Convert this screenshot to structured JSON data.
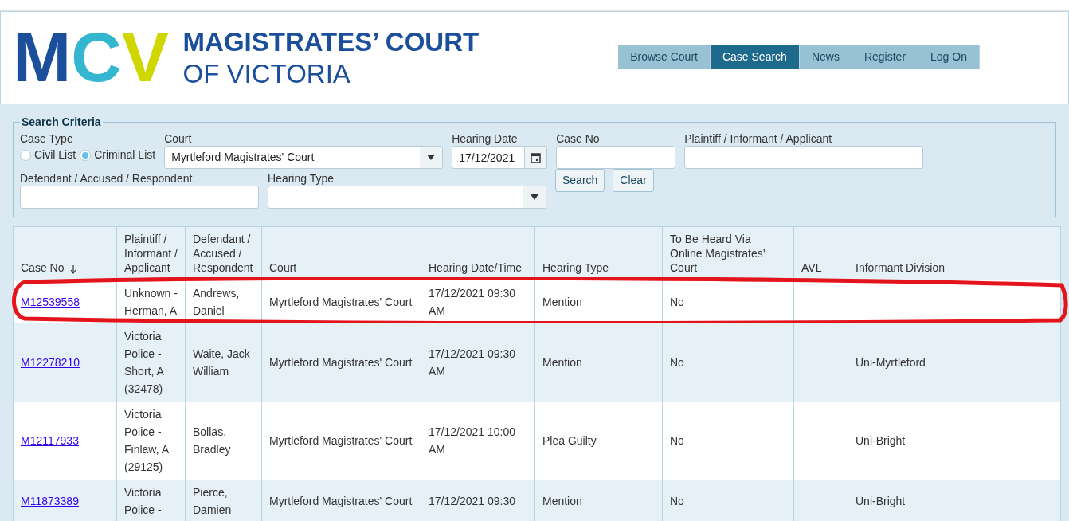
{
  "logo": {
    "mark": "MCV",
    "line_1": "MAGISTRATES’ COURT",
    "line_2": "OF VICTORIA"
  },
  "nav": [
    {
      "label": "Browse Court",
      "selected": false
    },
    {
      "label": "Case Search",
      "selected": true
    },
    {
      "label": "News",
      "selected": false
    },
    {
      "label": "Register",
      "selected": false
    },
    {
      "label": "Log On",
      "selected": false
    }
  ],
  "search": {
    "legend": "Search Criteria",
    "case_type": {
      "label": "Case Type",
      "options": [
        {
          "label": "Civil List",
          "selected": false
        },
        {
          "label": "Criminal List",
          "selected": true
        }
      ]
    },
    "court": {
      "label": "Court",
      "value": "Myrtleford Magistrates' Court"
    },
    "hearing_date": {
      "label": "Hearing Date",
      "value": "17/12/2021"
    },
    "case_no": {
      "label": "Case No"
    },
    "plaintiff": {
      "label": "Plaintiff / Informant / Applicant"
    },
    "defendant": {
      "label": "Defendant / Accused / Respondent"
    },
    "hearing_type": {
      "label": "Hearing Type"
    },
    "buttons": [
      "Search",
      "Clear"
    ]
  },
  "table": {
    "columns": [
      {
        "label": "Case No",
        "sorted": true
      },
      {
        "label": "Plaintiff / Informant / Applicant",
        "sorted": false
      },
      {
        "label": "Defendant / Accused / Respondent",
        "sorted": false
      },
      {
        "label": "Court",
        "sorted": false
      },
      {
        "label": "Hearing Date/Time",
        "sorted": false
      },
      {
        "label": "Hearing Type",
        "sorted": false
      },
      {
        "label": "To Be Heard Via Online Magistrates’ Court",
        "sorted": false
      },
      {
        "label": "AVL",
        "sorted": false
      },
      {
        "label": "Informant Division",
        "sorted": false
      }
    ],
    "rows": [
      {
        "circled": true,
        "cells": [
          "M12539558",
          "Unknown - Herman, A",
          "Andrews, Daniel",
          "Myrtleford Magistrates' Court",
          "17/12/2021 09:30 AM",
          "Mention",
          "No",
          null,
          null
        ]
      },
      {
        "circled": false,
        "cells": [
          "M12278210",
          "Victoria Police - Short, A (32478)",
          "Waite, Jack William",
          "Myrtleford Magistrates' Court",
          "17/12/2021 09:30 AM",
          "Mention",
          "No",
          null,
          "Uni-Myrtleford"
        ]
      },
      {
        "circled": false,
        "cells": [
          "M12117933",
          "Victoria Police - Finlaw, A (29125)",
          "Bollas, Bradley",
          "Myrtleford Magistrates' Court",
          "17/12/2021 10:00 AM",
          "Plea Guilty",
          "No",
          null,
          "Uni-Bright"
        ]
      },
      {
        "circled": false,
        "cells": [
          "M11873389",
          "Victoria Police -",
          "Pierce, Damien",
          "Myrtleford Magistrates' Court",
          "17/12/2021 09:30",
          "Mention",
          "No",
          null,
          "Uni-Bright"
        ]
      }
    ]
  }
}
